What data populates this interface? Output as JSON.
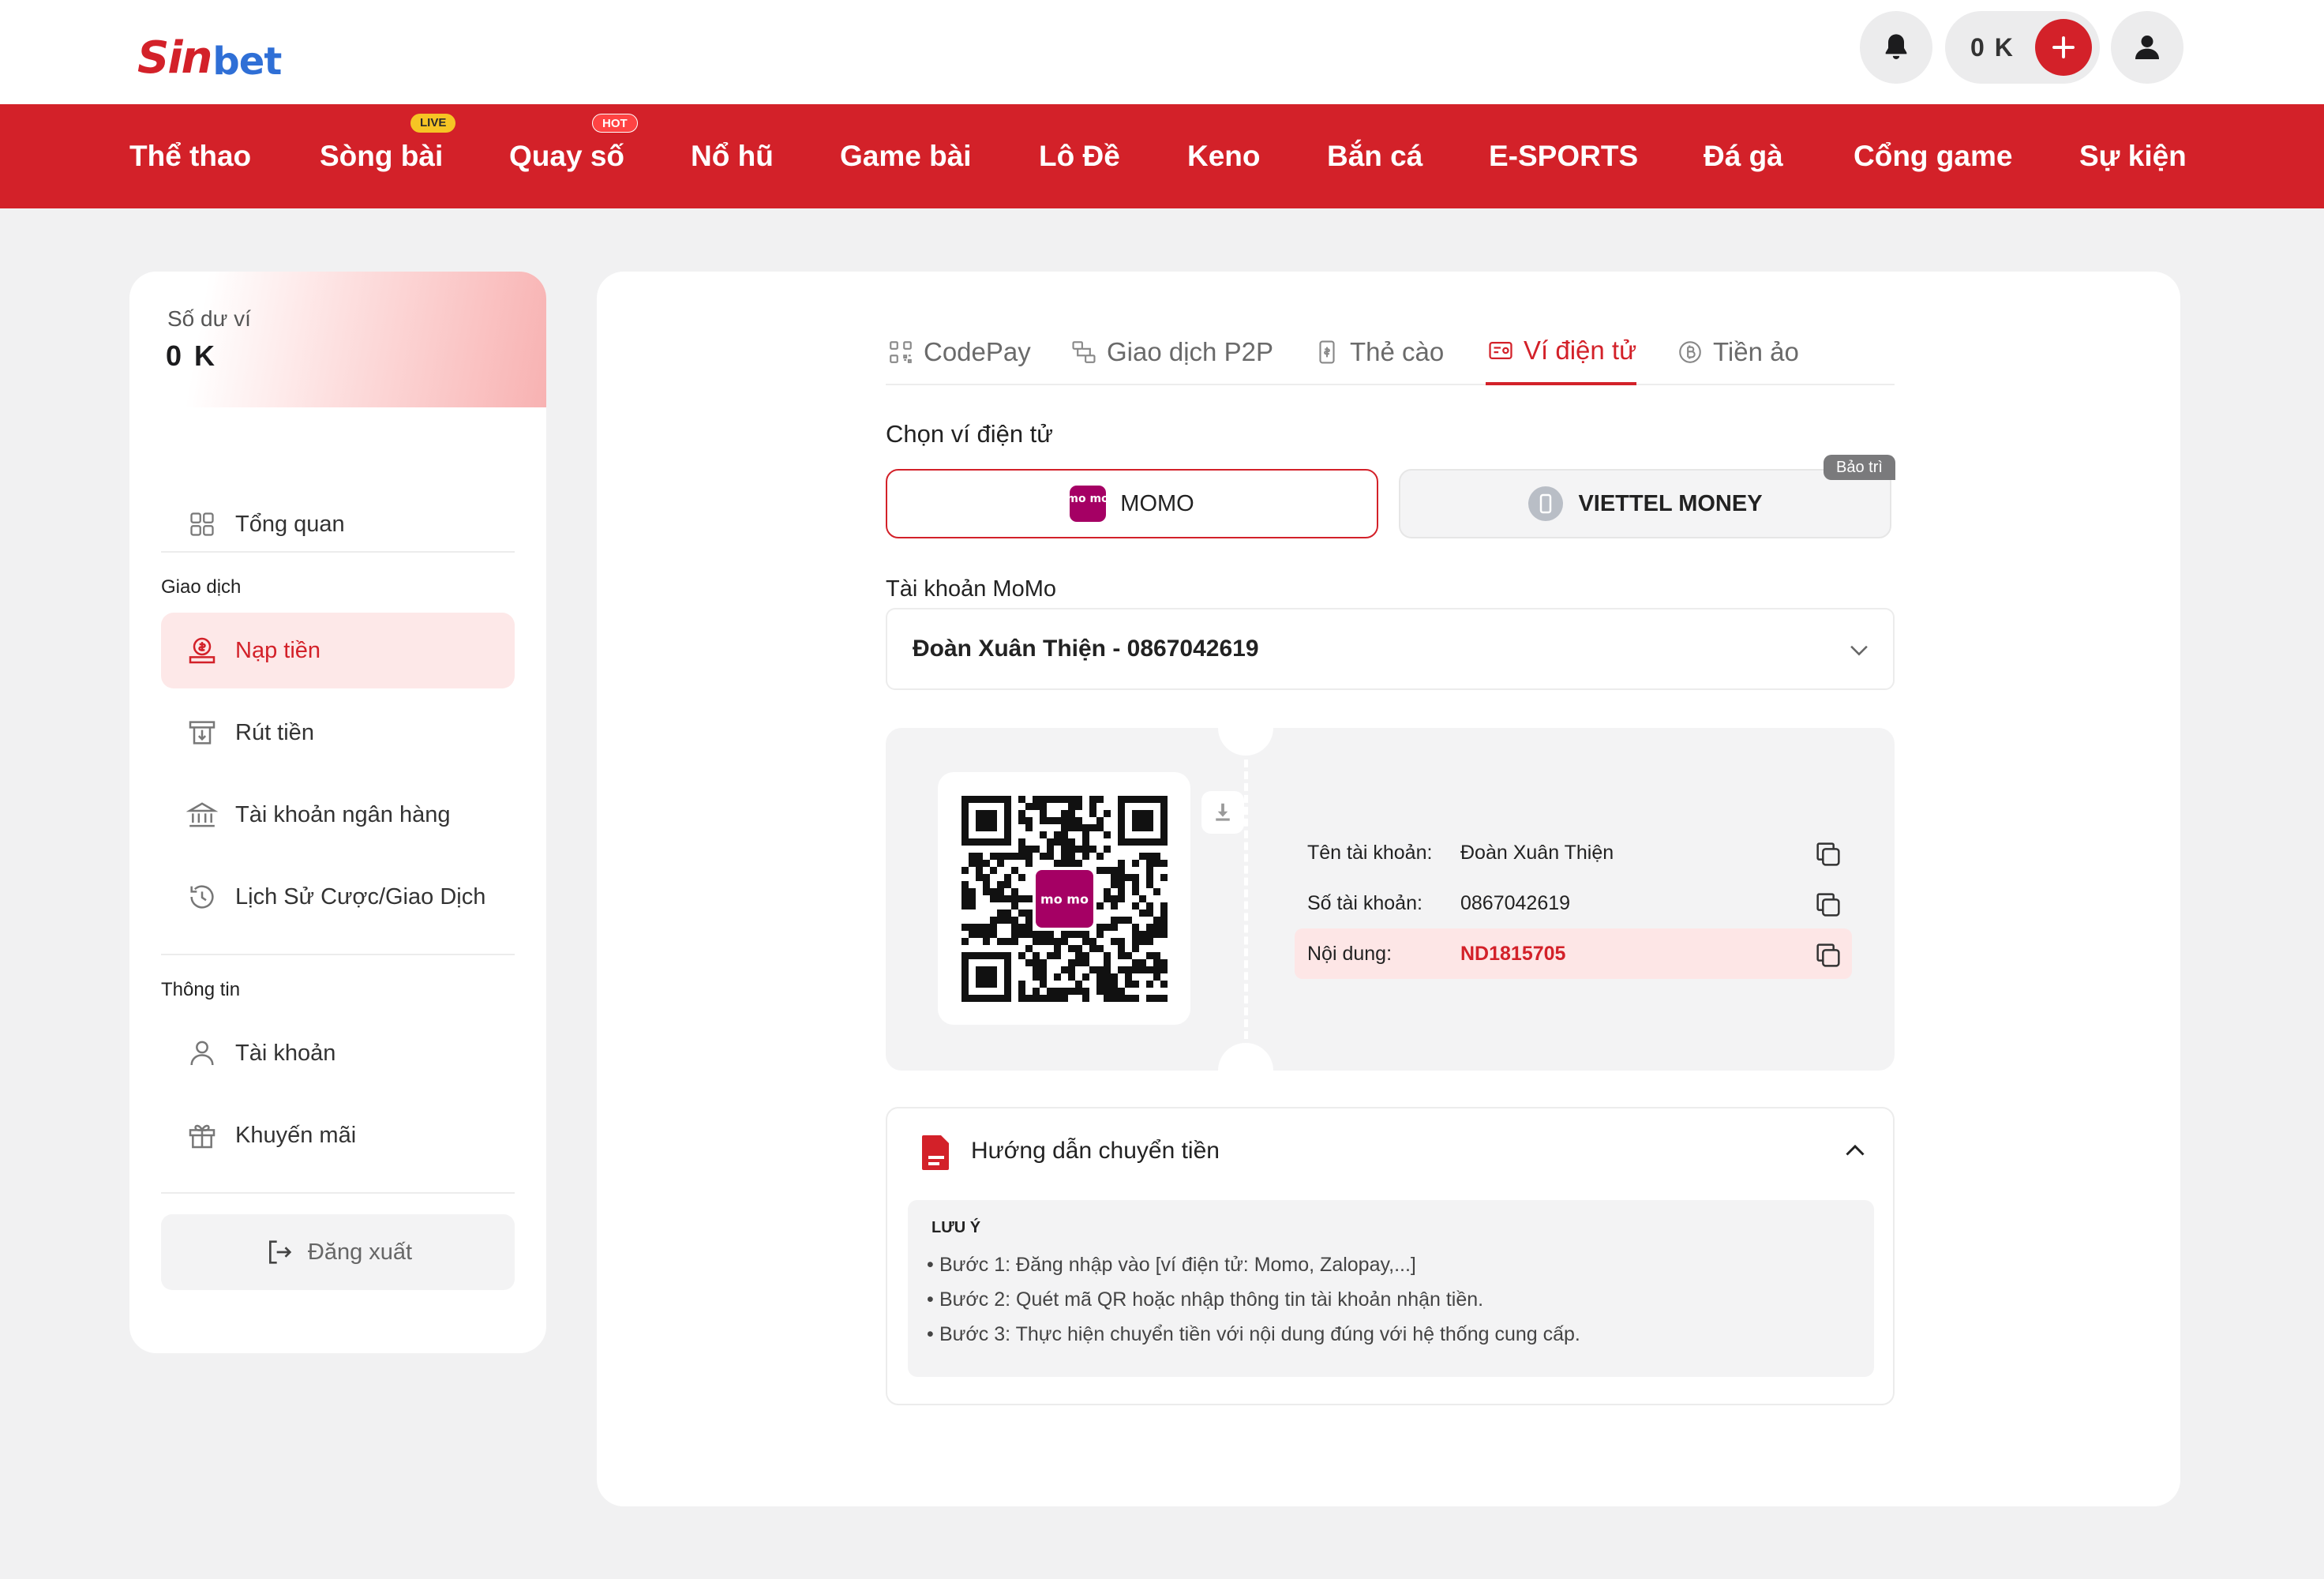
{
  "header": {
    "logo_part1": "Sin",
    "logo_part2": "bet",
    "balance": "0 K",
    "nav": [
      {
        "label": "Thể thao"
      },
      {
        "label": "Sòng bài",
        "badge": "LIVE"
      },
      {
        "label": "Quay số",
        "badge": "HOT"
      },
      {
        "label": "Nổ hũ"
      },
      {
        "label": "Game bài"
      },
      {
        "label": "Lô Đề"
      },
      {
        "label": "Keno"
      },
      {
        "label": "Bắn cá"
      },
      {
        "label": "E-SPORTS"
      },
      {
        "label": "Đá gà"
      },
      {
        "label": "Cổng game"
      },
      {
        "label": "Sự kiện"
      }
    ]
  },
  "sidebar": {
    "wallet_label": "Số dư ví",
    "wallet_amount": "0 K",
    "overview": "Tổng quan",
    "section_transactions": "Giao dịch",
    "deposit": "Nạp tiền",
    "withdraw": "Rút tiền",
    "bank_accounts": "Tài khoản ngân hàng",
    "history": "Lịch Sử Cược/Giao Dịch",
    "section_info": "Thông tin",
    "account": "Tài khoản",
    "promotions": "Khuyến mãi",
    "logout": "Đăng xuất"
  },
  "main": {
    "tabs": [
      {
        "label": "CodePay",
        "icon": "codepay-icon"
      },
      {
        "label": "Giao dịch P2P",
        "icon": "p2p-icon"
      },
      {
        "label": "Thẻ cào",
        "icon": "card-icon"
      },
      {
        "label": "Ví điện tử",
        "icon": "ewallet-icon",
        "active": true
      },
      {
        "label": "Tiền ảo",
        "icon": "bitcoin-icon"
      }
    ],
    "choose_wallet": "Chọn ví điện tử",
    "wallet_momo": "MOMO",
    "momo_logo": "mo mo",
    "wallet_viettel": "VIETTEL MONEY",
    "maintenance_badge": "Bảo trì",
    "account_label": "Tài khoản MoMo",
    "account_selected": "Đoàn Xuân Thiện - 0867042619",
    "qr_logo": "mo mo",
    "details": {
      "name_label": "Tên tài khoản:",
      "name_value": "Đoàn Xuân Thiện",
      "number_label": "Số tài khoản:",
      "number_value": "0867042619",
      "content_label": "Nội dung:",
      "content_value": "ND1815705"
    },
    "guide": {
      "title": "Hướng dẫn chuyển tiền",
      "note_title": "LƯU Ý",
      "steps": [
        "Bước 1: Đăng nhập vào [ví điện tử: Momo, Zalopay,...]",
        "Bước 2: Quét mã QR hoặc nhập thông tin tài khoản nhận tiền.",
        "Bước 3: Thực hiện chuyển tiền với nội dung đúng với hệ thống cung cấp."
      ]
    }
  },
  "colors": {
    "brand_red": "#d32129",
    "logo_blue": "#2f6fd6",
    "momo_pink": "#a50064",
    "badge_live": "#f6c524",
    "badge_hot": "#ff4343"
  }
}
